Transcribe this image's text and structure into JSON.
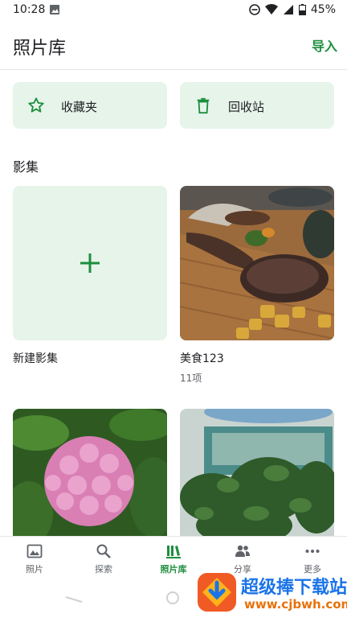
{
  "status": {
    "time": "10:28",
    "battery": "45%"
  },
  "header": {
    "title": "照片库",
    "import_label": "导入"
  },
  "quick_actions": [
    {
      "label": "收藏夹",
      "icon": "star-outline-icon"
    },
    {
      "label": "回收站",
      "icon": "trash-icon"
    }
  ],
  "albums_section": {
    "title": "影集"
  },
  "albums": [
    {
      "name": "新建影集",
      "icon": "plus-icon"
    },
    {
      "name": "美食123",
      "count": "11项"
    }
  ],
  "nav": [
    {
      "label": "照片",
      "icon": "photo-icon"
    },
    {
      "label": "探索",
      "icon": "search-icon"
    },
    {
      "label": "照片库",
      "icon": "library-icon",
      "active": true
    },
    {
      "label": "分享",
      "icon": "people-icon"
    },
    {
      "label": "更多",
      "icon": "more-icon"
    }
  ],
  "watermark": {
    "text": "超级捧下载站",
    "url": "www.cjbwh.com"
  },
  "colors": {
    "accent": "#1e8e3e",
    "tile_bg": "#e6f4ea"
  }
}
